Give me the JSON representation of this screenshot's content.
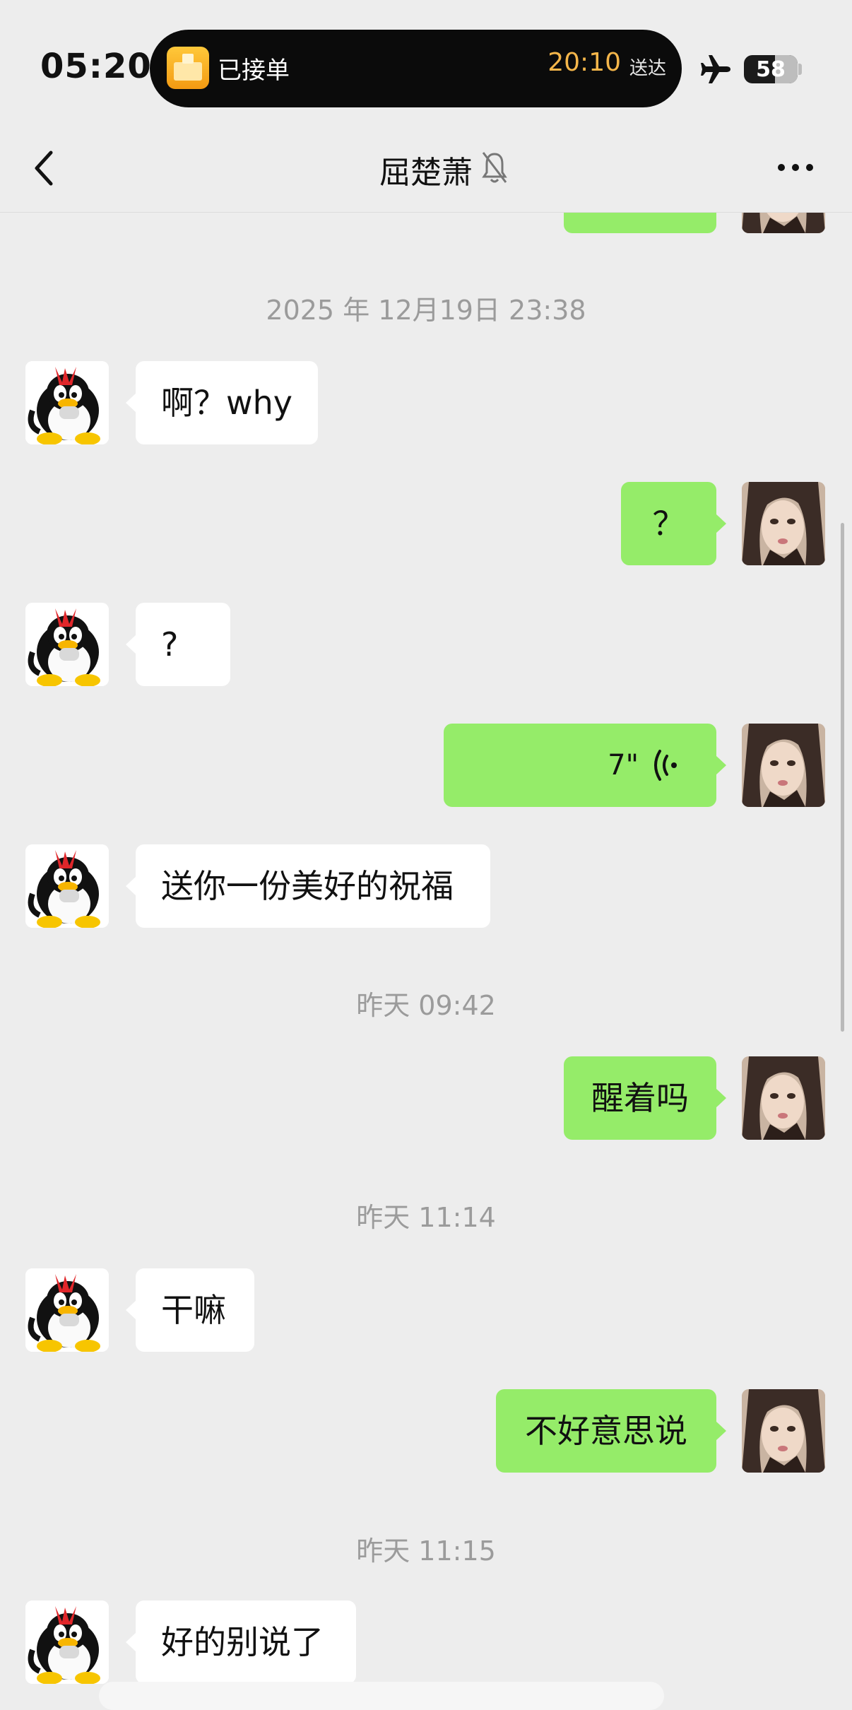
{
  "status_bar": {
    "time": "05:20",
    "island_label": "已接单",
    "island_time": "20:10",
    "island_suffix": "送达",
    "battery": "58",
    "icons": [
      "airplane-icon",
      "battery-icon",
      "order-box-icon"
    ]
  },
  "nav": {
    "title": "屈楚萧",
    "icons": [
      "back-chevron-icon",
      "mute-bell-icon",
      "more-dots-icon"
    ]
  },
  "chat": {
    "timestamps": [
      "2025 年 12月19日 23:38",
      "昨天 09:42",
      "昨天 11:14",
      "昨天 11:15"
    ],
    "messages": [
      {
        "side": "left",
        "text": "啊？why"
      },
      {
        "side": "right",
        "text": "？"
      },
      {
        "side": "left",
        "text": "?"
      },
      {
        "side": "right",
        "type": "voice",
        "duration": "7\""
      },
      {
        "side": "left",
        "text": "送你一份美好的祝福"
      },
      {
        "side": "right",
        "text": "醒着吗"
      },
      {
        "side": "left",
        "text": "干嘛"
      },
      {
        "side": "right",
        "text": "不好意思说"
      },
      {
        "side": "left",
        "text": "好的别说了"
      }
    ]
  },
  "colors": {
    "background": "#ededed",
    "sent_bubble": "#95ec69",
    "received_bubble": "#ffffff",
    "island_accent": "#f5b64a"
  }
}
